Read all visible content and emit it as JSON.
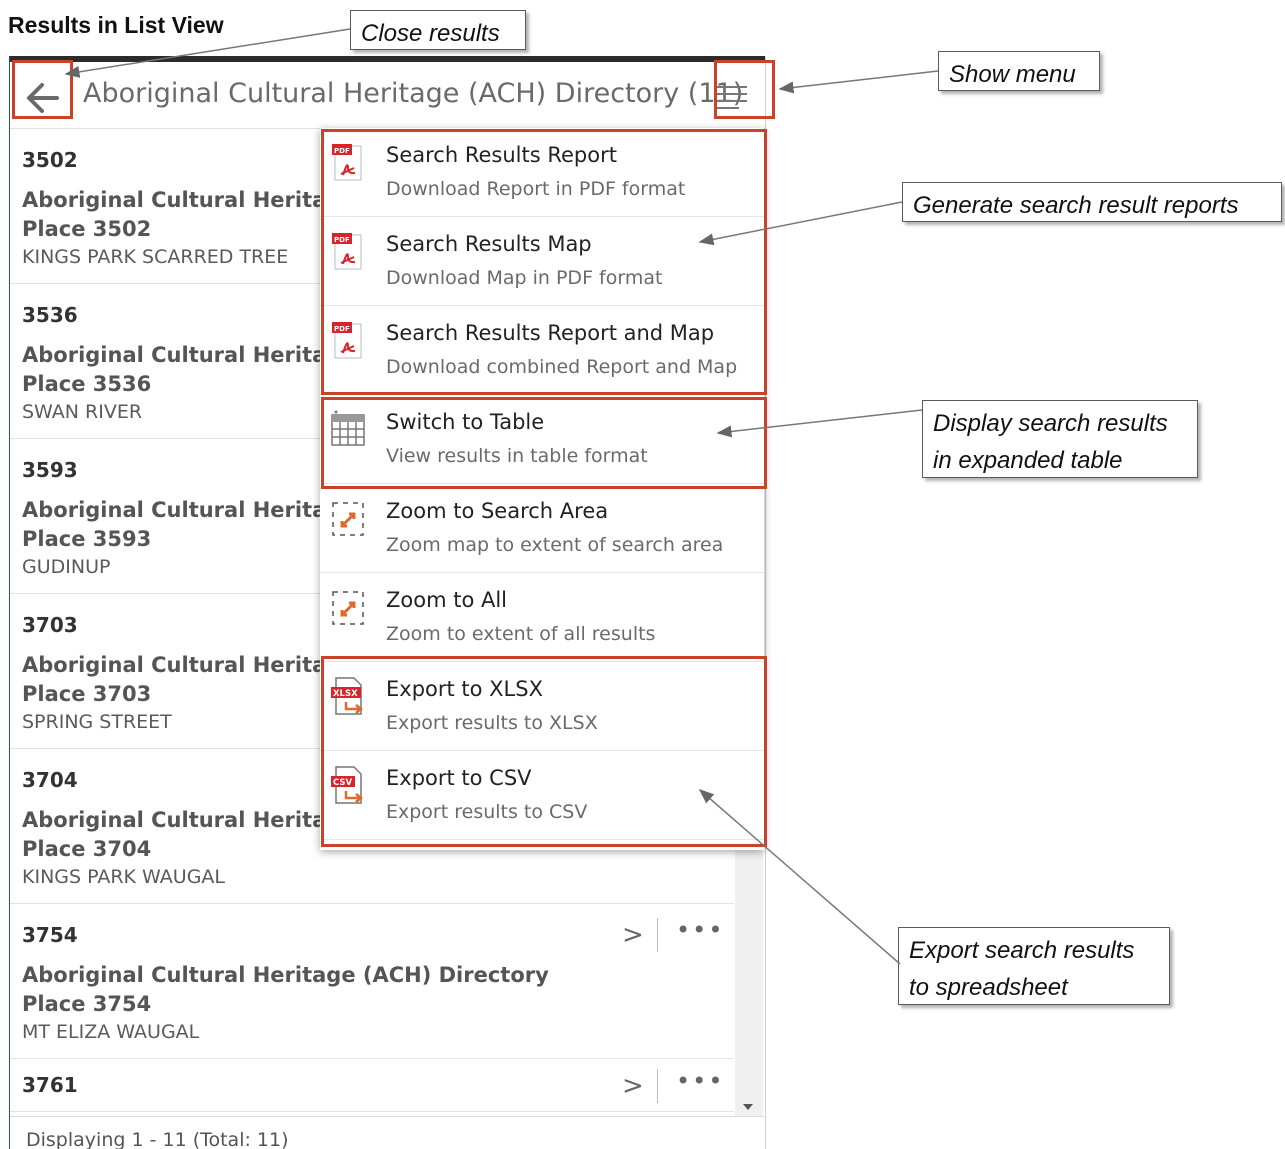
{
  "heading": "Results in List View",
  "panel": {
    "title": "Aboriginal Cultural Heritage (ACH) Directory (11)",
    "footer": "Displaying 1 - 11 (Total: 11)"
  },
  "results": [
    {
      "id": "3502",
      "title_line1": "Aboriginal Cultural Heritage",
      "title_line2": "Place 3502",
      "name": "KINGS PARK SCARRED TREE"
    },
    {
      "id": "3536",
      "title_line1": "Aboriginal Cultural Heritage",
      "title_line2": "Place 3536",
      "name": "SWAN RIVER"
    },
    {
      "id": "3593",
      "title_line1": "Aboriginal Cultural Heritage",
      "title_line2": "Place 3593",
      "name": "GUDINUP"
    },
    {
      "id": "3703",
      "title_line1": "Aboriginal Cultural Heritage",
      "title_line2": "Place 3703",
      "name": "SPRING STREET"
    },
    {
      "id": "3704",
      "title_line1": "Aboriginal Cultural Heritage",
      "title_line2": "Place 3704",
      "name": "KINGS PARK WAUGAL"
    },
    {
      "id": "3754",
      "title_line1": "Aboriginal Cultural Heritage (ACH) Directory",
      "title_line2": "Place 3754",
      "name": "MT ELIZA WAUGAL"
    },
    {
      "id": "3761"
    }
  ],
  "menu": [
    {
      "label": "Search Results Report",
      "sub": "Download Report in PDF format",
      "icon": "pdf-icon"
    },
    {
      "label": "Search Results Map",
      "sub": "Download Map in PDF format",
      "icon": "pdf-icon"
    },
    {
      "label": "Search Results Report and Map",
      "sub": "Download combined Report and Map",
      "icon": "pdf-icon"
    },
    {
      "label": "Switch to Table",
      "sub": "View results in table format",
      "icon": "table-icon"
    },
    {
      "label": "Zoom to Search Area",
      "sub": "Zoom map to extent of search area",
      "icon": "zoom-extent-icon"
    },
    {
      "label": "Zoom to All",
      "sub": "Zoom to extent of all results",
      "icon": "zoom-extent-icon"
    },
    {
      "label": "Export to XLSX",
      "sub": "Export results to XLSX",
      "icon": "xlsx-export-icon",
      "badge": "XLSX"
    },
    {
      "label": "Export to CSV",
      "sub": "Export results to CSV",
      "icon": "csv-export-icon",
      "badge": "CSV"
    }
  ],
  "callouts": {
    "close": "Close results",
    "show_menu": "Show menu",
    "reports": "Generate search result reports",
    "table": [
      "Display search results",
      "in expanded table"
    ],
    "export": [
      "Export search results",
      "to spreadsheet"
    ]
  },
  "colors": {
    "highlight": "#c9422a",
    "pdf_red": "#d8252b",
    "accent_orange": "#e06a2c"
  }
}
